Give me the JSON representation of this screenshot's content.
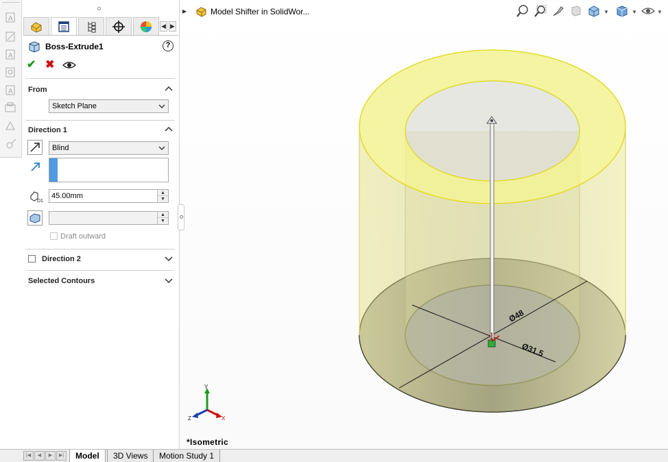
{
  "colors": {
    "accent_blue": "#4f9ae0",
    "ok_green": "#1e9a1e",
    "cancel_red": "#cc1111",
    "feature_yellow": "#f2f084",
    "sketch_face": "#6b6fb6"
  },
  "left_toolbar": {
    "icons": [
      "annotation-icon",
      "smart-dimension-icon",
      "note-icon",
      "balloon-icon",
      "auto-balloon-icon",
      "surface-finish-icon",
      "weld-symbol-icon",
      "hole-callout-icon"
    ]
  },
  "property_manager": {
    "tabs": [
      "feature-manager-icon",
      "property-manager-icon",
      "configuration-manager-icon",
      "dimxpert-icon",
      "display-manager-icon"
    ],
    "feature_title": "Boss-Extrude1",
    "help": "?",
    "from": {
      "label": "From",
      "value": "Sketch Plane"
    },
    "direction1": {
      "label": "Direction 1",
      "end_condition": "Blind",
      "depth": "45.00mm",
      "draft_outward": "Draft outward"
    },
    "direction2": {
      "label": "Direction 2"
    },
    "selected_contours": {
      "label": "Selected Contours"
    }
  },
  "graphics": {
    "model_name": "Model Shifter in SolidWor...",
    "view_name": "*Isometric",
    "dim_outer": "Ø48",
    "dim_inner": "Ø31.5",
    "triad": {
      "x": "X",
      "y": "Y",
      "z": "Z"
    }
  },
  "bottom_tabs": [
    "Model",
    "3D Views",
    "Motion Study 1"
  ]
}
